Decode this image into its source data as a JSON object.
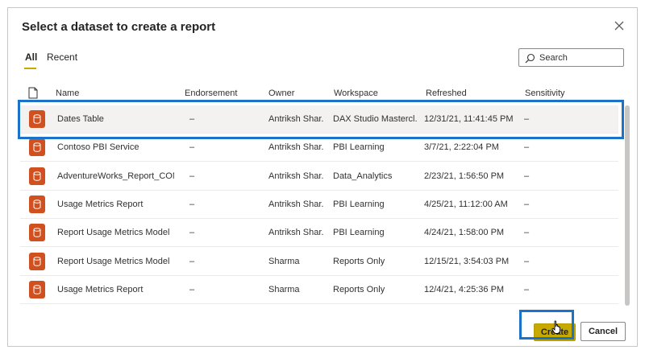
{
  "dialog": {
    "title": "Select a dataset to create a report",
    "close_icon": "close-icon"
  },
  "tabs": [
    {
      "label": "All",
      "active": true
    },
    {
      "label": "Recent",
      "active": false
    }
  ],
  "search": {
    "placeholder": "Search",
    "icon": "search-icon"
  },
  "columns": {
    "name": "Name",
    "endorsement": "Endorsement",
    "owner": "Owner",
    "workspace": "Workspace",
    "refreshed": "Refreshed",
    "sensitivity": "Sensitivity"
  },
  "rows": [
    {
      "name": "Dates Table",
      "endorsement": "–",
      "owner": "Antriksh Shar...",
      "workspace": "DAX Studio Mastercl...",
      "refreshed": "12/31/21, 11:41:45 PM",
      "sensitivity": "–",
      "selected": true
    },
    {
      "name": "Contoso PBI Service",
      "endorsement": "–",
      "owner": "Antriksh Shar...",
      "workspace": "PBI Learning",
      "refreshed": "3/7/21, 2:22:04 PM",
      "sensitivity": "–"
    },
    {
      "name": "AdventureWorks_Report_COM...",
      "endorsement": "–",
      "owner": "Antriksh Shar...",
      "workspace": "Data_Analytics",
      "refreshed": "2/23/21, 1:56:50 PM",
      "sensitivity": "–"
    },
    {
      "name": "Usage Metrics Report",
      "endorsement": "–",
      "owner": "Antriksh Shar...",
      "workspace": "PBI Learning",
      "refreshed": "4/25/21, 11:12:00 AM",
      "sensitivity": "–"
    },
    {
      "name": "Report Usage Metrics Model",
      "endorsement": "–",
      "owner": "Antriksh Shar...",
      "workspace": "PBI Learning",
      "refreshed": "4/24/21, 1:58:00 PM",
      "sensitivity": "–"
    },
    {
      "name": "Report Usage Metrics Model",
      "endorsement": "–",
      "owner": "Sharma",
      "workspace": "Reports Only",
      "refreshed": "12/15/21, 3:54:03 PM",
      "sensitivity": "–"
    },
    {
      "name": "Usage Metrics Report",
      "endorsement": "–",
      "owner": "Sharma",
      "workspace": "Reports Only",
      "refreshed": "12/4/21, 4:25:36 PM",
      "sensitivity": "–"
    }
  ],
  "footer": {
    "create_label": "Create",
    "cancel_label": "Cancel"
  },
  "colors": {
    "accent": "#c8a900",
    "dataset_icon": "#d0501f",
    "highlight": "#1a73c8"
  }
}
